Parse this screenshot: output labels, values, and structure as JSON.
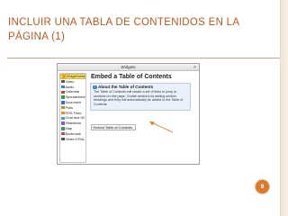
{
  "slide": {
    "title_line1": "INCLUIR UNA TABLA DE CONTENIDOS EN LA",
    "title_line2": "PÁGINA (1)",
    "page_number": "9",
    "accent_color": "#d97a2c",
    "title_color": "#c0581f"
  },
  "window": {
    "title": "Widgets",
    "close_label": "✕"
  },
  "sidebar": {
    "items": [
      {
        "label": "Widgetmeta",
        "icon": "star-icon",
        "color": "#e8a010"
      },
      {
        "label": "Video",
        "icon": "video-icon",
        "color": "#555555"
      },
      {
        "label": "Audio",
        "icon": "audio-icon",
        "color": "#3a7ad0"
      },
      {
        "label": "Calendar",
        "icon": "calendar-icon",
        "color": "#c84030"
      },
      {
        "label": "Spreadsheet",
        "icon": "spreadsheet-icon",
        "color": "#2e9a3c"
      },
      {
        "label": "Document",
        "icon": "document-icon",
        "color": "#3a6ac8"
      },
      {
        "label": "Polls",
        "icon": "polls-icon",
        "color": "#d08a20"
      },
      {
        "label": "RSS Feed",
        "icon": "rss-icon",
        "color": "#f08a1c"
      },
      {
        "label": "Chat and IM",
        "icon": "chat-icon",
        "color": "#3aa0e0"
      },
      {
        "label": "Slideshow",
        "icon": "slideshow-icon",
        "color": "#8a5ac8"
      },
      {
        "label": "Map",
        "icon": "map-icon",
        "color": "#3a9a5a"
      },
      {
        "label": "Bookmark",
        "icon": "bookmark-icon",
        "color": "#c83a6a"
      },
      {
        "label": "Other HTML",
        "icon": "html-icon",
        "color": "#555555"
      }
    ],
    "selected_index": 0
  },
  "content": {
    "heading": "Embed a Table of Contents",
    "about_title": "About the Table of Contents",
    "about_icon": "info-icon",
    "about_text": "The Table of Contents will create a set of links to jump to sections on this page. Create sections by adding section headings and they will automatically be added to the Table of Contents",
    "embed_button": "Embed Table of Contents"
  }
}
